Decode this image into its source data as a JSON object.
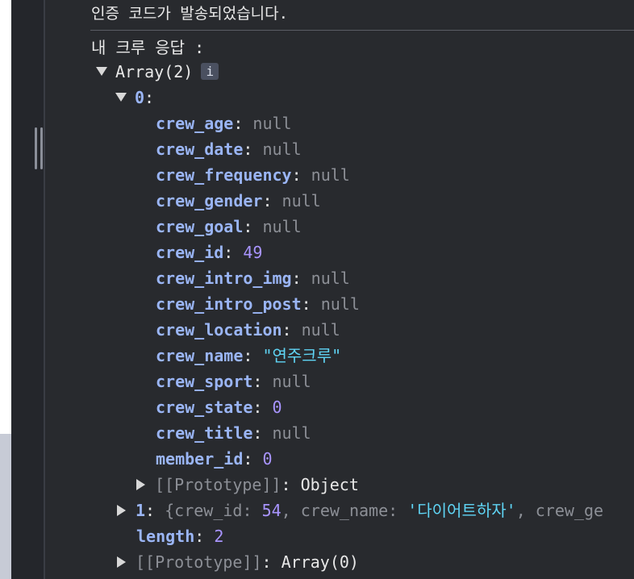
{
  "console": {
    "message_top": "인증 코드가 발송되었습니다.",
    "label_line": "내 크루 응답 :",
    "array_label": "Array(2)",
    "info_badge": "i",
    "index0": "0",
    "index0_colon": ":",
    "fields": [
      {
        "key": "crew_age",
        "value": "null",
        "type": "null"
      },
      {
        "key": "crew_date",
        "value": "null",
        "type": "null"
      },
      {
        "key": "crew_frequency",
        "value": "null",
        "type": "null"
      },
      {
        "key": "crew_gender",
        "value": "null",
        "type": "null"
      },
      {
        "key": "crew_goal",
        "value": "null",
        "type": "null"
      },
      {
        "key": "crew_id",
        "value": "49",
        "type": "num"
      },
      {
        "key": "crew_intro_img",
        "value": "null",
        "type": "null"
      },
      {
        "key": "crew_intro_post",
        "value": "null",
        "type": "null"
      },
      {
        "key": "crew_location",
        "value": "null",
        "type": "null"
      },
      {
        "key": "crew_name",
        "value": "\"연주크루\"",
        "type": "str"
      },
      {
        "key": "crew_sport",
        "value": "null",
        "type": "null"
      },
      {
        "key": "crew_state",
        "value": "0",
        "type": "num"
      },
      {
        "key": "crew_title",
        "value": "null",
        "type": "null"
      },
      {
        "key": "member_id",
        "value": "0",
        "type": "num"
      }
    ],
    "prototype_object": {
      "key": "[[Prototype]]",
      "value": "Object"
    },
    "item1": {
      "index": "1",
      "prefix": "{crew_id: ",
      "crew_id": "54",
      "mid": ", crew_name: ",
      "crew_name": "'다이어트하자'",
      "suffix": ", crew_ge"
    },
    "length": {
      "key": "length",
      "value": "2"
    },
    "prototype_array": {
      "key": "[[Prototype]]",
      "value": "Array(0)"
    }
  }
}
